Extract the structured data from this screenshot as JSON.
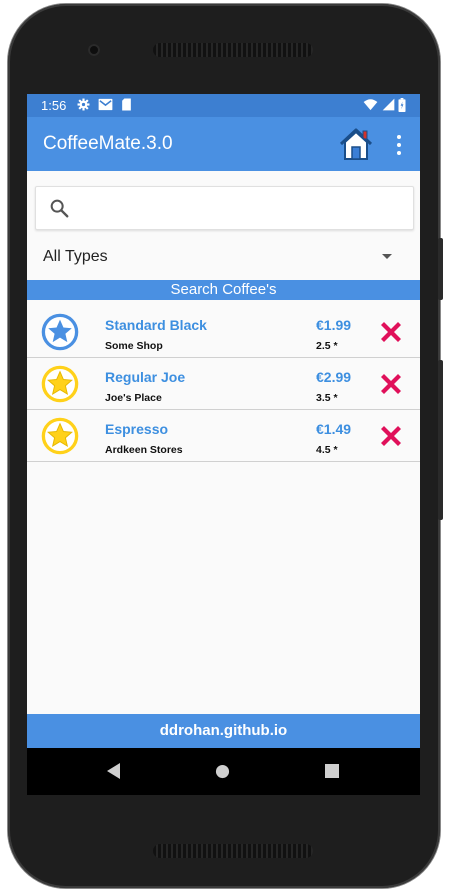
{
  "status_bar": {
    "time": "1:56",
    "icons": [
      "gear-icon",
      "gmail-icon",
      "sd-card-icon",
      "wifi-icon",
      "signal-icon",
      "battery-icon"
    ]
  },
  "app_bar": {
    "title": "CoffeeMate.3.0",
    "home_icon": "home-icon",
    "menu_icon": "more-vert-icon"
  },
  "search": {
    "value": "",
    "placeholder": "",
    "icon": "search-icon"
  },
  "type_filter": {
    "selected": "All Types"
  },
  "section_header": "Search Coffee's",
  "coffees": [
    {
      "name": "Standard Black",
      "shop": "Some Shop",
      "price": "€1.99",
      "rating": "2.5 *",
      "favourite": false
    },
    {
      "name": "Regular Joe",
      "shop": "Joe's Place",
      "price": "€2.99",
      "rating": "3.5 *",
      "favourite": true
    },
    {
      "name": "Espresso",
      "shop": "Ardkeen Stores",
      "price": "€1.49",
      "rating": "4.5 *",
      "favourite": true
    }
  ],
  "footer": "ddrohan.github.io",
  "nav_bar": [
    "back-icon",
    "home-circle-icon",
    "recents-icon"
  ],
  "colors": {
    "primary": "#4a90e2",
    "status_bar": "#3d7fd1",
    "link_text": "#3d8fe0",
    "favourite_star": "#ffd11a",
    "normal_star": "#4a90e2",
    "delete": "#e0105a"
  }
}
